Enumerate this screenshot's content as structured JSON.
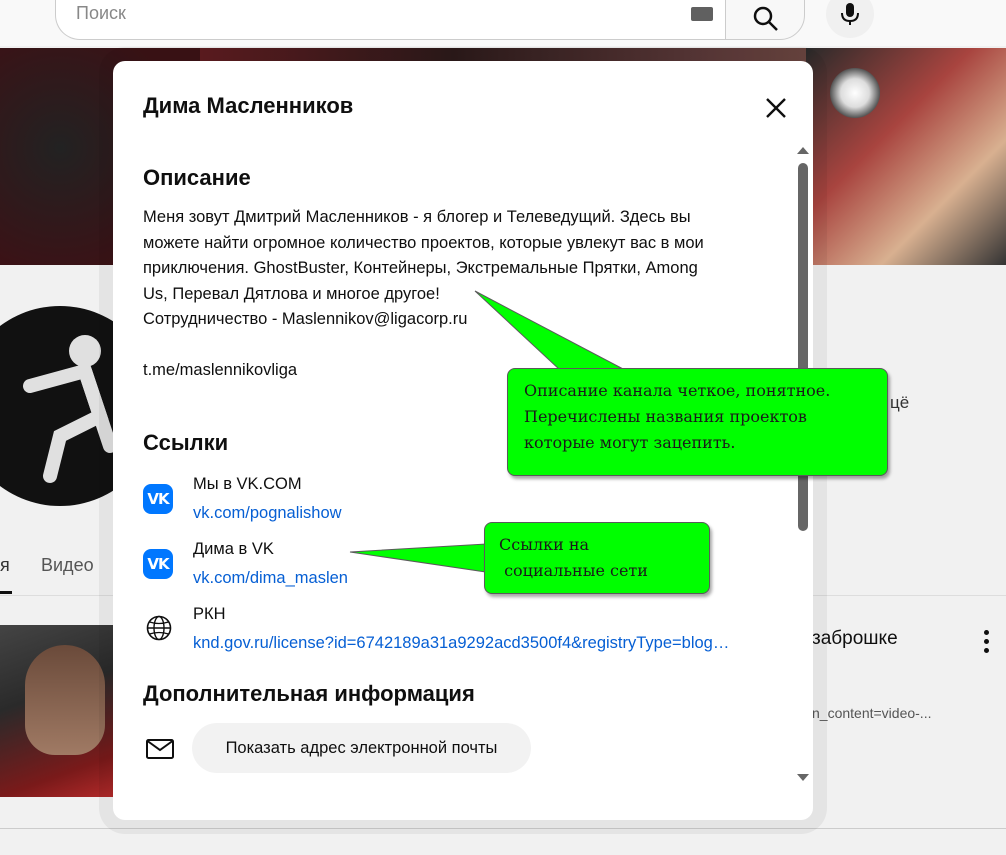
{
  "background": {
    "search_placeholder": "Поиск",
    "tab_active_fragment": "я",
    "tab_video": "Видео",
    "side_letter": "цё",
    "video_title_fragment": "заброшке",
    "video_url_fragment": "n_content=video-..."
  },
  "modal": {
    "title": "Дима Масленников",
    "description_heading": "Описание",
    "description_lines": [
      "Меня зовут Дмитрий Масленников - я блогер и Телеведущий. Здесь вы",
      "можете найти огромное количество проектов, которые увлекут вас в мои",
      "приключения. GhostBuster, Контейнеры, Экстремальные Прятки, Among",
      "Us, Перевал Дятлова и многое другое!",
      "Сотрудничество - Maslennikov@ligacorp.ru",
      "",
      "t.me/maslennikovliga"
    ],
    "links_heading": "Ссылки",
    "links": [
      {
        "title": "Мы в VK.COM",
        "url": "vk.com/pognalishow",
        "icon": "vk-icon"
      },
      {
        "title": "Дима в VK",
        "url": "vk.com/dima_maslen",
        "icon": "vk-icon"
      },
      {
        "title": "РКН",
        "url": "knd.gov.ru/license?id=6742189a31a9292acd3500f4&registryType=blog…",
        "icon": "globe-icon"
      }
    ],
    "additional_heading": "Дополнительная информация",
    "email_button": "Показать адрес электронной почты",
    "vk_glyph": "VK"
  },
  "annotations": [
    {
      "lines": [
        "Описание канала четкое, понятное.",
        "Перечислены названия проектов",
        "которые могут зацепить."
      ]
    },
    {
      "lines": [
        "Ссылки на",
        " социальные сети"
      ]
    }
  ],
  "colors": {
    "link": "#065fd4",
    "vk": "#0077ff",
    "callout": "#00ff00"
  }
}
